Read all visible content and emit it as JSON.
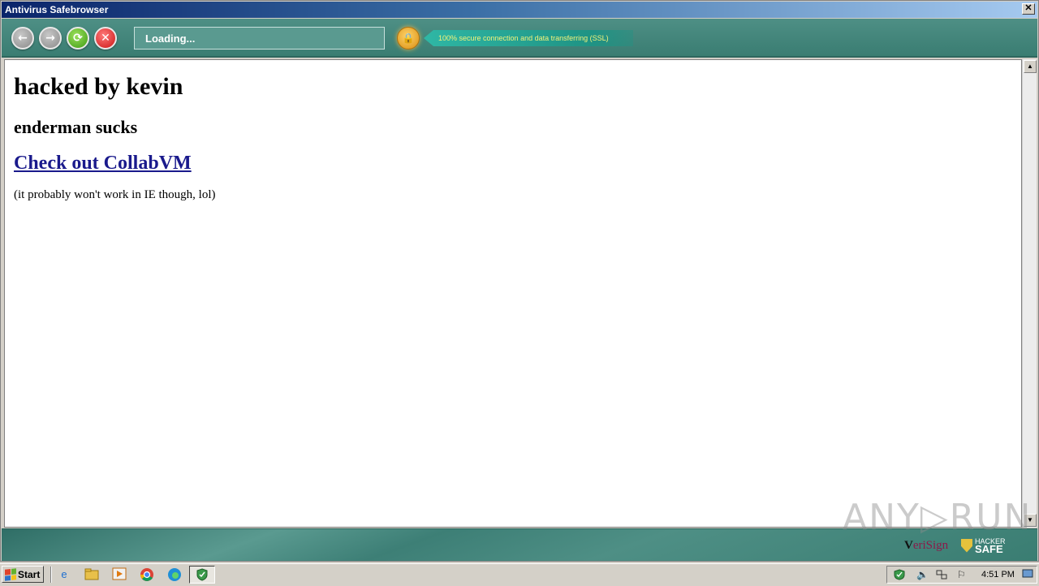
{
  "window": {
    "title": "Antivirus Safebrowser",
    "close_glyph": "✕"
  },
  "toolbar": {
    "back_icon": "←",
    "forward_icon": "→",
    "reload_icon": "⟳",
    "stop_icon": "✕",
    "address_value": "Loading...",
    "lock_icon": "🔒",
    "ssl_text": "100% secure connection and data transferring (SSL)"
  },
  "page": {
    "heading": "hacked by kevin",
    "subheading": "enderman sucks",
    "link": "Check out CollabVM",
    "note": "(it probably won't work in IE though, lol)"
  },
  "footer": {
    "verisign_v": "V",
    "verisign_rest": "eriSign",
    "hackersafe_top": "HACKER",
    "hackersafe_bottom": "SAFE"
  },
  "watermark": "ANY▷RUN",
  "taskbar": {
    "start_label": "Start",
    "clock": "4:51 PM"
  },
  "colors": {
    "toolbar": "#4e8f85",
    "link": "#1a1a8c",
    "ssl_text": "#f2f27a"
  }
}
